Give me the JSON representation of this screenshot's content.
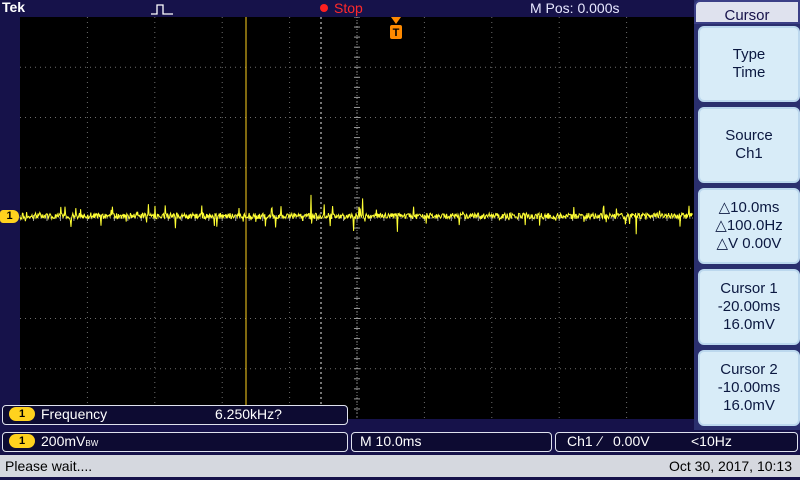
{
  "header": {
    "brand": "Tek",
    "trigger_icon": "pulse-trigger-icon",
    "run_state": "Stop",
    "mpos": "M Pos: 0.000s"
  },
  "colors": {
    "trace": "#ffff33",
    "cursor": "#ffd21e",
    "trigger": "#ff8a00",
    "stop": "#ff2a2a"
  },
  "waveform": {
    "channel": "1",
    "level_label": "1"
  },
  "panel": {
    "title": "Cursor",
    "buttons": [
      {
        "lines": [
          "Type",
          "Time"
        ]
      },
      {
        "lines": [
          "Source",
          "Ch1"
        ]
      },
      {
        "lines": [
          "△10.0ms",
          "△100.0Hz",
          "△V 0.00V"
        ]
      },
      {
        "lines": [
          "Cursor 1",
          "-20.00ms",
          "16.0mV"
        ]
      },
      {
        "lines": [
          "Cursor 2",
          "-10.00ms",
          "16.0mV"
        ]
      }
    ]
  },
  "measurement": {
    "channel": "1",
    "name": "Frequency",
    "value": "6.250kHz?"
  },
  "vertical": {
    "channel": "1",
    "scale": "200mV",
    "bw_suffix": "BW"
  },
  "horizontal": {
    "scale": "M 10.0ms"
  },
  "trigger": {
    "source": "Ch1",
    "slope": "∕",
    "level": "0.00V",
    "freq": "<10Hz"
  },
  "status": {
    "message": "Please wait....",
    "datetime": "Oct 30, 2017, 10:13"
  }
}
